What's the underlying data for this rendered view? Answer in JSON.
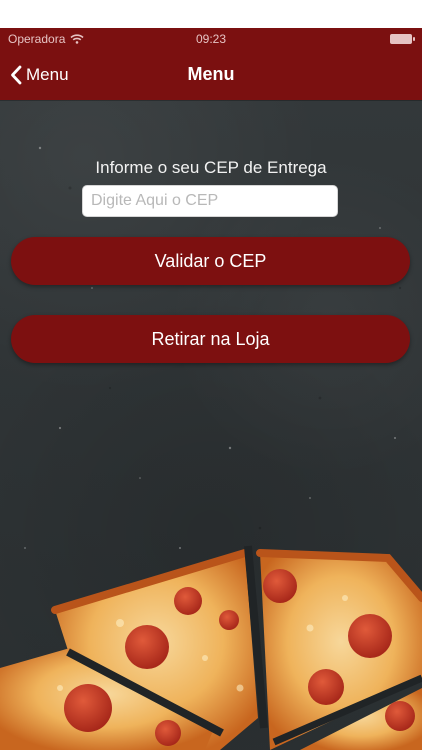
{
  "status_bar": {
    "carrier": "Operadora",
    "time": "09:23"
  },
  "nav": {
    "back_label": "Menu",
    "title": "Menu"
  },
  "form": {
    "cep_label": "Informe o seu CEP de Entrega",
    "cep_placeholder": "Digite Aqui o CEP",
    "cep_value": ""
  },
  "actions": {
    "validate_label": "Validar o CEP",
    "pickup_label": "Retirar na Loja"
  },
  "colors": {
    "brand": "#7b1010",
    "background": "#2f3436"
  },
  "icons": {
    "back": "chevron-left-icon",
    "wifi": "wifi-icon",
    "battery": "battery-icon"
  }
}
